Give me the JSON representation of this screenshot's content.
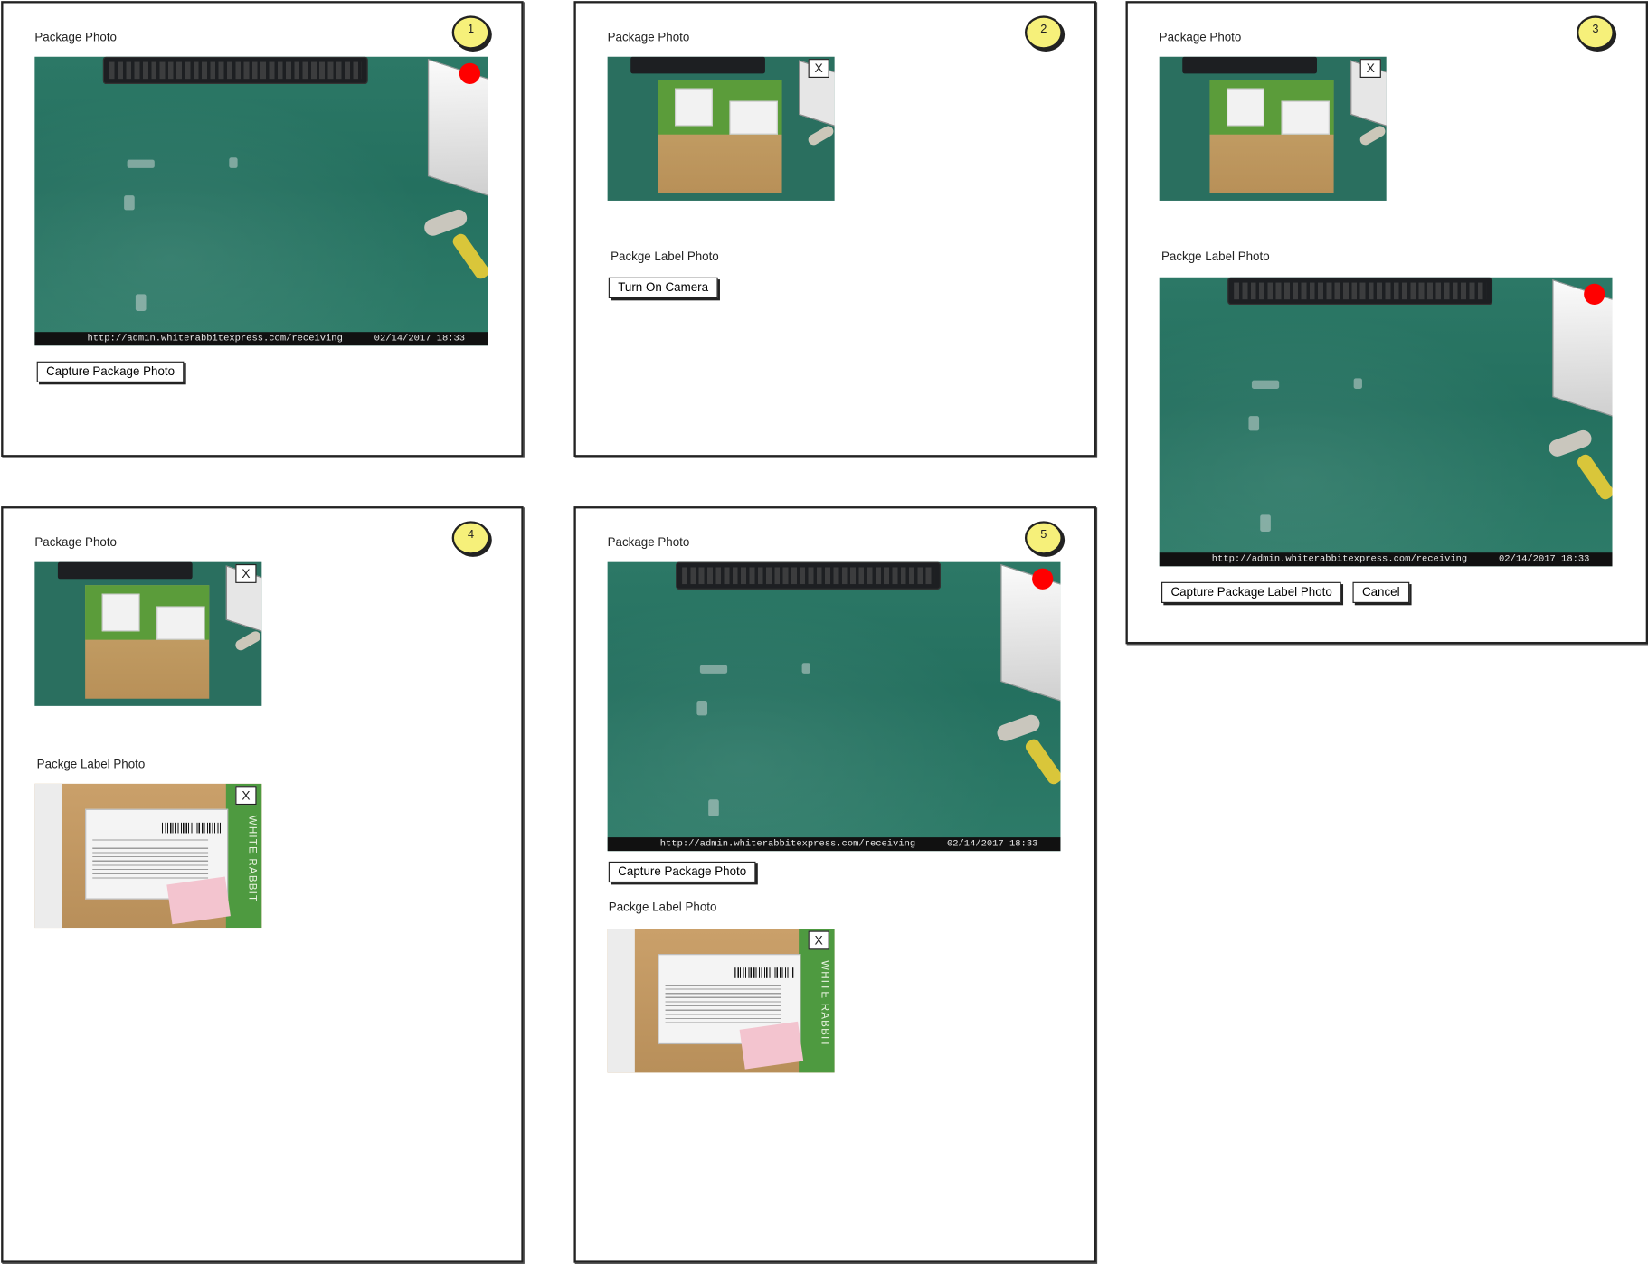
{
  "screens": [
    {
      "badge": "1",
      "package_photo_label": "Package Photo",
      "camera_url": "http://admin.whiterabbitexpress.com/receiving",
      "camera_timestamp": "02/14/2017 18:33",
      "capture_button": "Capture Package Photo"
    },
    {
      "badge": "2",
      "package_photo_label": "Package Photo",
      "close_label": "X",
      "label_photo_label": "Packge Label Photo",
      "turn_on_camera_button": "Turn On Camera"
    },
    {
      "badge": "3",
      "package_photo_label": "Package Photo",
      "close_label": "X",
      "label_photo_label": "Packge Label Photo",
      "camera_url": "http://admin.whiterabbitexpress.com/receiving",
      "camera_timestamp": "02/14/2017 18:33",
      "capture_label_button": "Capture Package Label Photo",
      "cancel_button": "Cancel"
    },
    {
      "badge": "4",
      "package_photo_label": "Package Photo",
      "close_label": "X",
      "label_photo_label": "Packge Label Photo",
      "label_close_label": "X"
    },
    {
      "badge": "5",
      "package_photo_label": "Package Photo",
      "camera_url": "http://admin.whiterabbitexpress.com/receiving",
      "camera_timestamp": "02/14/2017 18:33",
      "capture_button": "Capture Package Photo",
      "label_photo_label": "Packge Label Photo",
      "label_close_label": "X"
    }
  ],
  "label_image_text": "WHITE RABBIT",
  "colors": {
    "badge": "#f6f07a",
    "record_dot": "#ff0000",
    "mat_green": "#2c7866"
  }
}
